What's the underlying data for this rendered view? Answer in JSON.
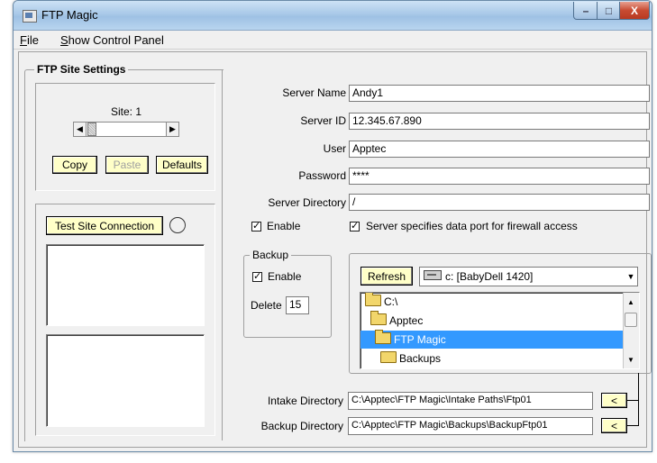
{
  "window": {
    "title": "FTP Magic",
    "minimize_glyph": "–",
    "maximize_glyph": "□",
    "close_glyph": "X"
  },
  "menu": {
    "file": "File",
    "file_accel": "F",
    "file_rest": "ile",
    "show_control_panel": "Show Control Panel",
    "scp_accel": "S",
    "scp_rest": "how Control Panel"
  },
  "site_settings": {
    "legend": "FTP Site Settings",
    "site_label": "Site: 1",
    "copy_label": "Copy",
    "paste_label": "Paste",
    "defaults_label": "Defaults",
    "test_connection_label": "Test Site Connection"
  },
  "server": {
    "name_label": "Server Name",
    "name_value": "Andy1",
    "id_label": "Server ID",
    "id_value": "12.345.67.890",
    "user_label": "User",
    "user_value": "Apptec",
    "password_label": "Password",
    "password_value": "****",
    "directory_label": "Server Directory",
    "directory_value": "/",
    "enable_label": "Enable",
    "enable_checked": true,
    "firewall_label": "Server specifies data port for firewall access",
    "firewall_checked": true
  },
  "backup": {
    "legend": "Backup",
    "enable_label": "Enable",
    "enable_checked": true,
    "delete_label": "Delete",
    "delete_value": "15"
  },
  "browser": {
    "refresh_label": "Refresh",
    "drive_value": "c: [BabyDell 1420]",
    "tree": [
      {
        "label": "C:\\",
        "indent": 0,
        "selected": false
      },
      {
        "label": "Apptec",
        "indent": 1,
        "selected": false
      },
      {
        "label": "FTP Magic",
        "indent": 2,
        "selected": true
      },
      {
        "label": "Backups",
        "indent": 3,
        "selected": false
      }
    ]
  },
  "directories": {
    "intake_label": "Intake Directory",
    "intake_value": "C:\\Apptec\\FTP Magic\\Intake Paths\\Ftp01",
    "backup_label": "Backup Directory",
    "backup_value": "C:\\Apptec\\FTP Magic\\Backups\\BackupFtp01",
    "set_button_label": "<"
  },
  "colors": {
    "button_face": "#ffffc8",
    "selection": "#3399ff",
    "window_bg": "#f0f0f0"
  }
}
